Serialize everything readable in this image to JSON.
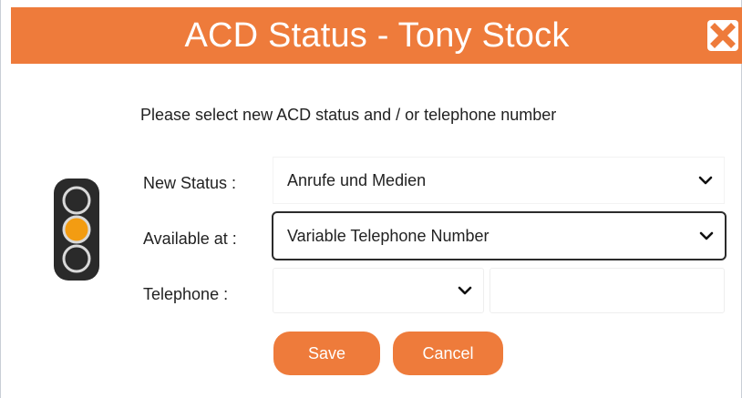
{
  "dialog": {
    "title": "ACD Status - Tony Stock",
    "close_icon": "close-x-icon"
  },
  "instruction": "Please select new ACD status and / or telephone number",
  "status_indicator": {
    "icon": "traffic-light-icon",
    "active_light": "middle",
    "active_color": "#f39c12"
  },
  "form": {
    "new_status": {
      "label": "New Status :",
      "value": "Anrufe und Medien"
    },
    "available_at": {
      "label": "Available at :",
      "value": "Variable Telephone Number"
    },
    "telephone": {
      "label": "Telephone :",
      "prefix_value": "",
      "number_value": ""
    }
  },
  "buttons": {
    "save": "Save",
    "cancel": "Cancel"
  },
  "colors": {
    "accent": "#ee7b3b",
    "light_active": "#f39c12"
  }
}
